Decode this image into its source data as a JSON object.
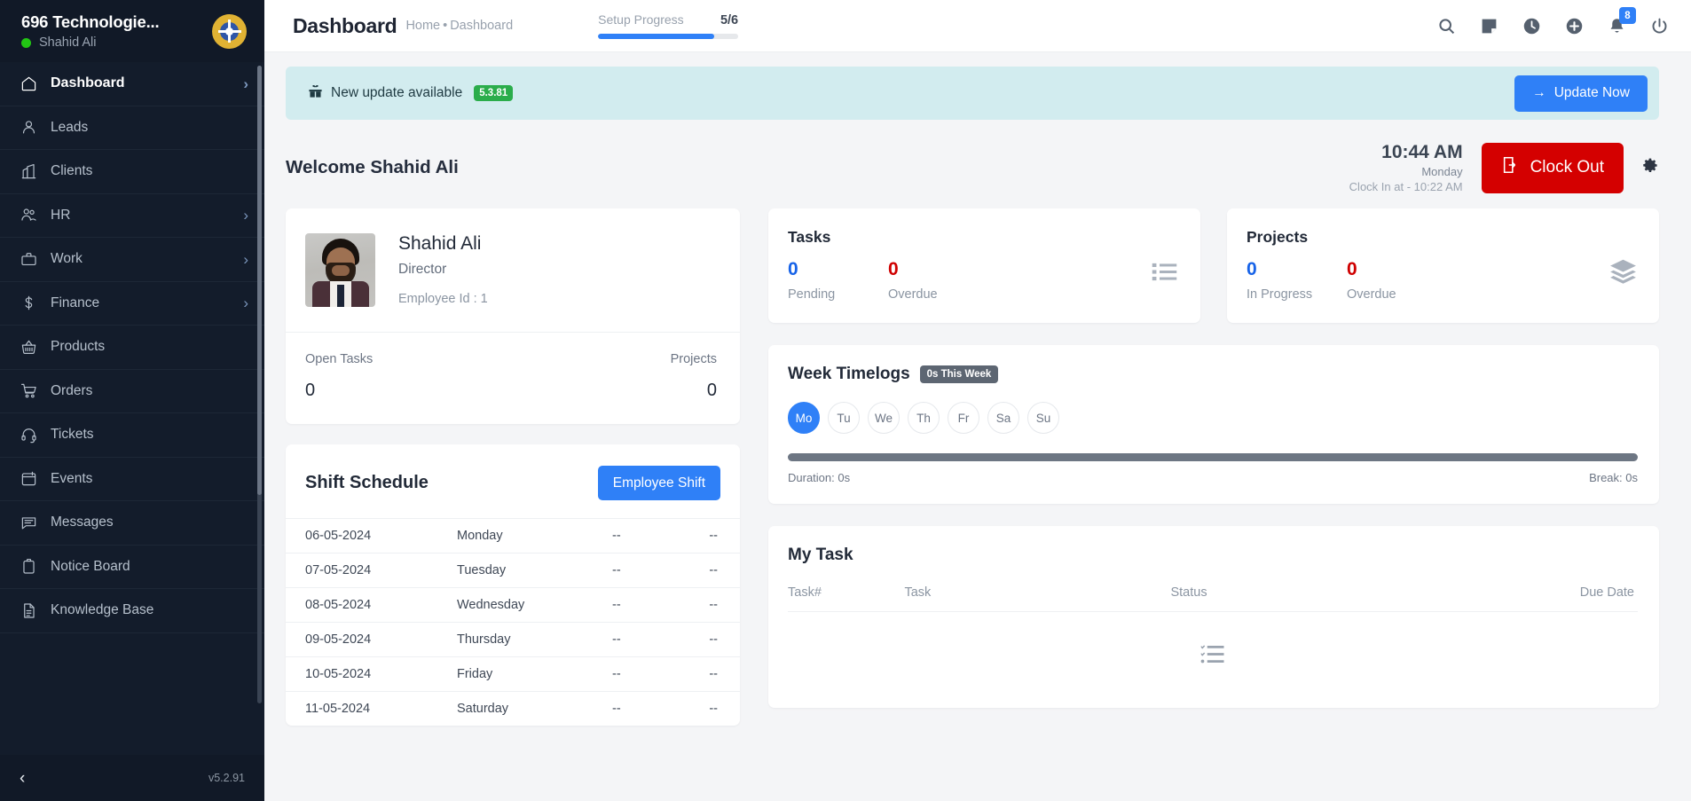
{
  "sidebar": {
    "company": "696 Technologie...",
    "user": "Shahid Ali",
    "status_color": "#22c514",
    "version": "v5.2.91",
    "items": [
      {
        "label": "Dashboard",
        "icon": "home-icon",
        "chevron": "›",
        "active": true
      },
      {
        "label": "Leads",
        "icon": "user-icon",
        "chevron": "",
        "active": false
      },
      {
        "label": "Clients",
        "icon": "building-icon",
        "chevron": "",
        "active": false
      },
      {
        "label": "HR",
        "icon": "users-icon",
        "chevron": "›",
        "active": false
      },
      {
        "label": "Work",
        "icon": "briefcase-icon",
        "chevron": "›",
        "active": false
      },
      {
        "label": "Finance",
        "icon": "dollar-icon",
        "chevron": "›",
        "active": false
      },
      {
        "label": "Products",
        "icon": "basket-icon",
        "chevron": "",
        "active": false
      },
      {
        "label": "Orders",
        "icon": "cart-icon",
        "chevron": "",
        "active": false
      },
      {
        "label": "Tickets",
        "icon": "headset-icon",
        "chevron": "",
        "active": false
      },
      {
        "label": "Events",
        "icon": "calendar-icon",
        "chevron": "",
        "active": false
      },
      {
        "label": "Messages",
        "icon": "chat-icon",
        "chevron": "",
        "active": false
      },
      {
        "label": "Notice Board",
        "icon": "clipboard-icon",
        "chevron": "",
        "active": false
      },
      {
        "label": "Knowledge Base",
        "icon": "document-icon",
        "chevron": "",
        "active": false
      }
    ]
  },
  "topbar": {
    "title": "Dashboard",
    "breadcrumb_home": "Home",
    "breadcrumb_sep": "•",
    "breadcrumb_current": "Dashboard",
    "setup_label": "Setup Progress",
    "setup_count": "5/6",
    "setup_percent": 83,
    "accent_color": "#2f80f7",
    "icons": [
      {
        "name": "search-icon"
      },
      {
        "name": "note-icon"
      },
      {
        "name": "clock-icon"
      },
      {
        "name": "plus-circle-icon"
      },
      {
        "name": "bell-icon",
        "badge": "8"
      },
      {
        "name": "power-icon"
      }
    ]
  },
  "banner": {
    "icon": "gift-icon",
    "text": "New update available",
    "version": "5.3.81",
    "version_color": "#2bad4b",
    "button_label": "Update Now",
    "button_icon": "arrow-right-icon"
  },
  "welcome": {
    "title": "Welcome Shahid Ali",
    "time": "10:44 AM",
    "day": "Monday",
    "clock_in": "Clock In at - 10:22 AM",
    "clock_button_label": "Clock Out",
    "clock_button_color": "#d40000",
    "settings_icon": "gear-icon"
  },
  "profile": {
    "name": "Shahid Ali",
    "role": "Director",
    "employee_id": "Employee Id : 1",
    "stats": [
      {
        "label": "Open Tasks",
        "value": "0"
      },
      {
        "label": "Projects",
        "value": "0"
      }
    ]
  },
  "shift": {
    "title": "Shift Schedule",
    "button_label": "Employee Shift",
    "rows": [
      {
        "date": "06-05-2024",
        "day": "Monday",
        "a": "--",
        "b": "--"
      },
      {
        "date": "07-05-2024",
        "day": "Tuesday",
        "a": "--",
        "b": "--"
      },
      {
        "date": "08-05-2024",
        "day": "Wednesday",
        "a": "--",
        "b": "--"
      },
      {
        "date": "09-05-2024",
        "day": "Thursday",
        "a": "--",
        "b": "--"
      },
      {
        "date": "10-05-2024",
        "day": "Friday",
        "a": "--",
        "b": "--"
      },
      {
        "date": "11-05-2024",
        "day": "Saturday",
        "a": "--",
        "b": "--"
      }
    ]
  },
  "tasks_card": {
    "title": "Tasks",
    "icon": "list-icon",
    "items": [
      {
        "value": "0",
        "label": "Pending",
        "color": "#1763e8"
      },
      {
        "value": "0",
        "label": "Overdue",
        "color": "#cf0000"
      }
    ]
  },
  "projects_card": {
    "title": "Projects",
    "icon": "layers-icon",
    "items": [
      {
        "value": "0",
        "label": "In Progress",
        "color": "#1763e8"
      },
      {
        "value": "0",
        "label": "Overdue",
        "color": "#cf0000"
      }
    ]
  },
  "week_timelogs": {
    "title": "Week Timelogs",
    "pill": "0s This Week",
    "days": [
      {
        "label": "Mo",
        "active": true
      },
      {
        "label": "Tu",
        "active": false
      },
      {
        "label": "We",
        "active": false
      },
      {
        "label": "Th",
        "active": false
      },
      {
        "label": "Fr",
        "active": false
      },
      {
        "label": "Sa",
        "active": false
      },
      {
        "label": "Su",
        "active": false
      }
    ],
    "duration": "Duration: 0s",
    "break": "Break: 0s"
  },
  "my_task": {
    "title": "My Task",
    "columns": [
      "Task#",
      "Task",
      "Status",
      "Due Date"
    ],
    "rows": [],
    "empty_icon": "checklist-icon"
  }
}
